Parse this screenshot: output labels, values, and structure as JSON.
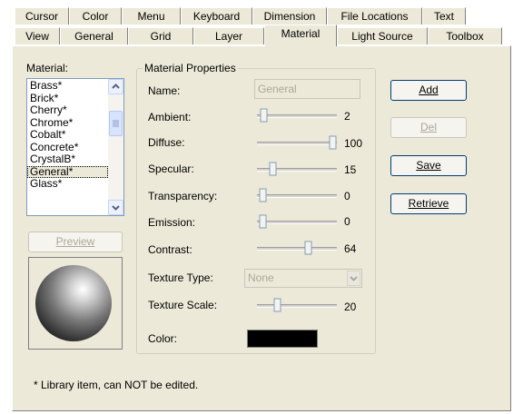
{
  "tabs": {
    "row1": [
      {
        "label": "Cursor",
        "w": 60
      },
      {
        "label": "Color",
        "w": 58
      },
      {
        "label": "Menu",
        "w": 65
      },
      {
        "label": "Keyboard",
        "w": 79
      },
      {
        "label": "Dimension",
        "w": 82
      },
      {
        "label": "File Locations",
        "w": 105
      },
      {
        "label": "Text",
        "w": 48
      }
    ],
    "row2": [
      {
        "label": "View",
        "w": 50
      },
      {
        "label": "General",
        "w": 75
      },
      {
        "label": "Grid",
        "w": 72
      },
      {
        "label": "Layer",
        "w": 78
      },
      {
        "label": "Material",
        "w": 80,
        "active": true
      },
      {
        "label": "Light Source",
        "w": 100
      },
      {
        "label": "Toolbox",
        "w": 82
      }
    ]
  },
  "material": {
    "label": "Material:",
    "items": [
      "Brass*",
      "Brick*",
      "Cherry*",
      "Chrome*",
      "Cobalt*",
      "Concrete*",
      "CrystalB*",
      "General*",
      "Glass*"
    ],
    "selected": "General*"
  },
  "preview_button": "Preview",
  "properties": {
    "legend": "Material Properties",
    "name_label": "Name:",
    "name_value": "General",
    "ambient_label": "Ambient:",
    "ambient_value": "2",
    "diffuse_label": "Diffuse:",
    "diffuse_value": "100",
    "specular_label": "Specular:",
    "specular_value": "15",
    "transparency_label": "Transparency:",
    "transparency_value": "0",
    "emission_label": "Emission:",
    "emission_value": "0",
    "contrast_label": "Contrast:",
    "contrast_value": "64",
    "texture_type_label": "Texture Type:",
    "texture_type_value": "None",
    "texture_scale_label": "Texture Scale:",
    "texture_scale_value": "20",
    "color_label": "Color:",
    "color_value": "#000000"
  },
  "buttons": {
    "add": "Add",
    "del": "Del",
    "save": "Save",
    "retrieve": "Retrieve"
  },
  "footnote": "* Library item, can NOT be edited."
}
